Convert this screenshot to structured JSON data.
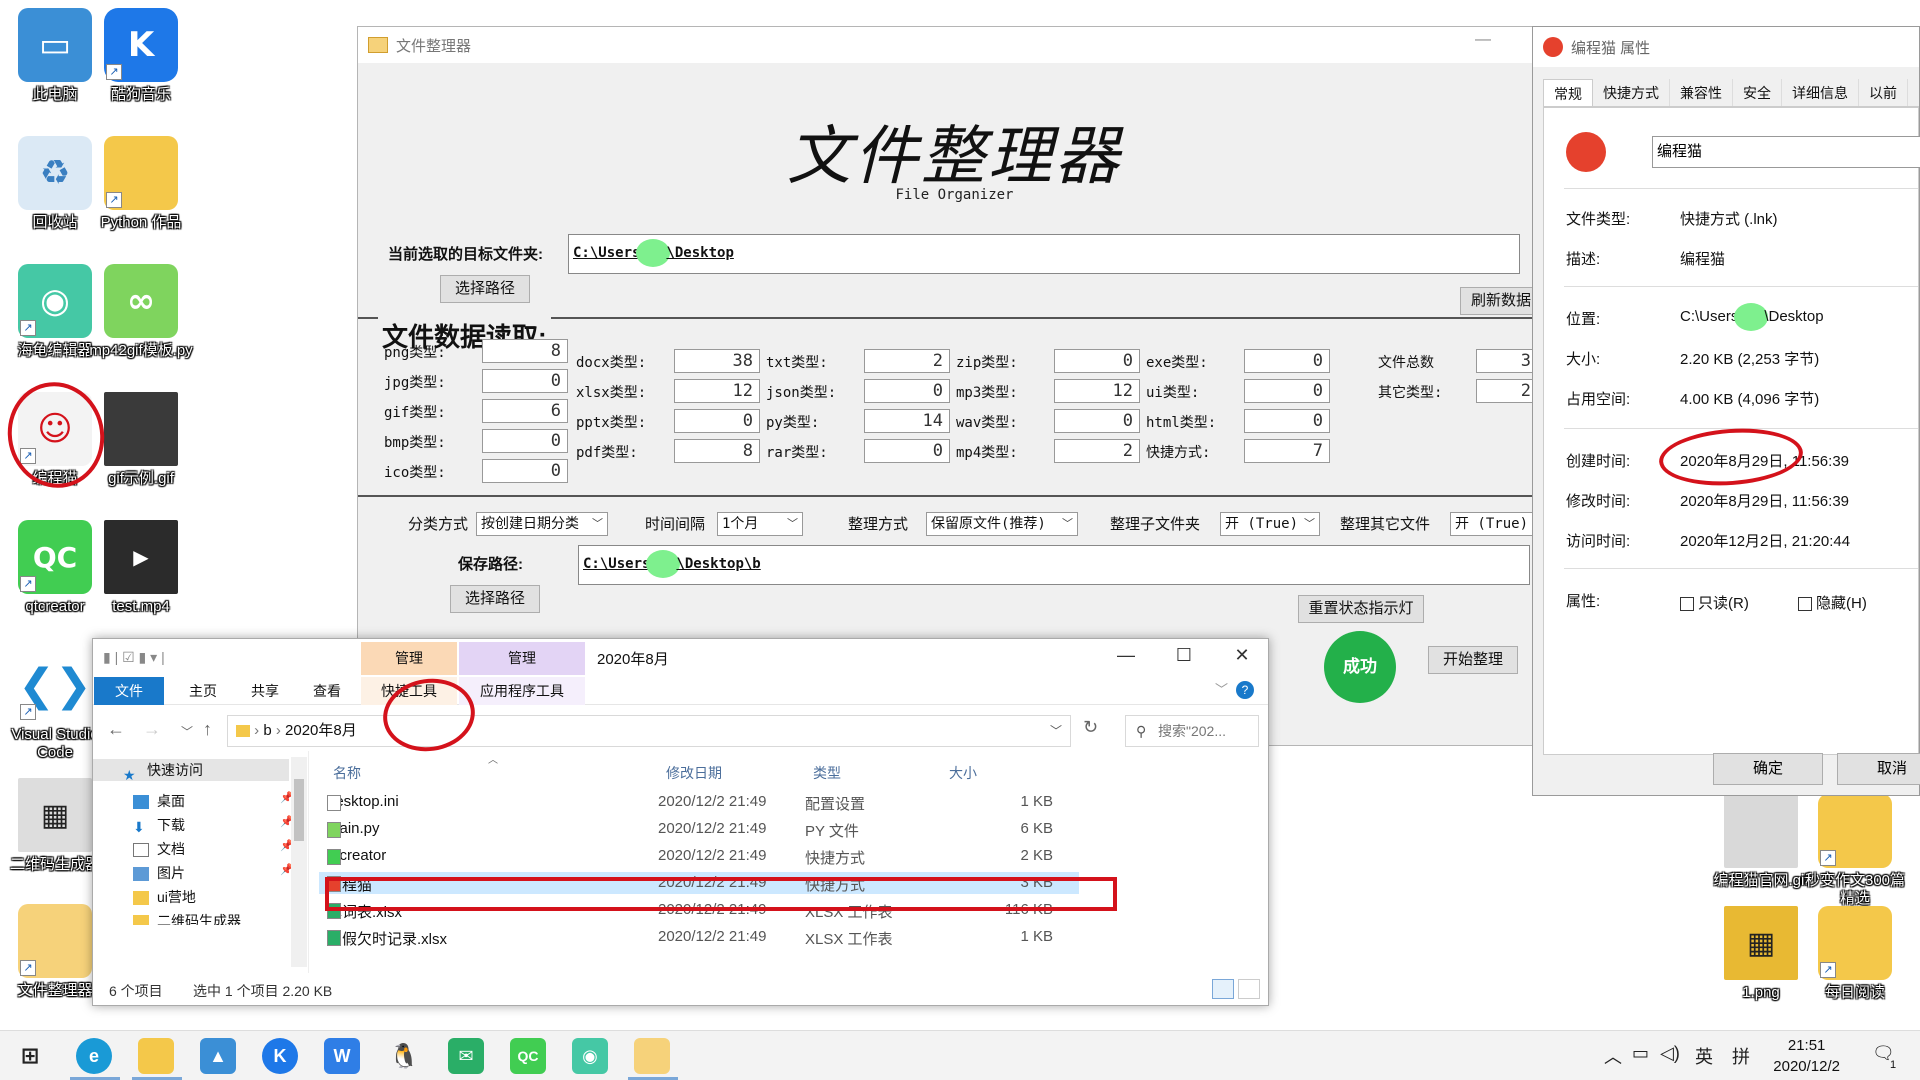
{
  "desktop": {
    "icons": [
      {
        "label": "此电脑"
      },
      {
        "label": "酷狗音乐"
      },
      {
        "label": "回收站"
      },
      {
        "label": "Python 作品"
      },
      {
        "label": "海龟编辑器"
      },
      {
        "label": "mp42gif模板.py"
      },
      {
        "label": "编程猫"
      },
      {
        "label": "gif示例.gif"
      },
      {
        "label": "qtcreator"
      },
      {
        "label": "test.mp4"
      },
      {
        "label": "Visual Studio Code"
      },
      {
        "label": "二维码生成器"
      },
      {
        "label": "文件整理器"
      },
      {
        "label": "编程猫官网.gif"
      },
      {
        "label": "秒变作文300篇精选"
      },
      {
        "label": "1.png"
      },
      {
        "label": "每日阅读"
      }
    ]
  },
  "app": {
    "window_title": "文件整理器",
    "title": "文件整理器",
    "subtitle": "File Organizer",
    "target_label": "当前选取的目标文件夹:",
    "target_path_a": "C:\\Users",
    "target_path_b": "\\Desktop",
    "choose_path_btn": "选择路径",
    "refresh_btn": "刷新数据",
    "section_title": "文件数据读取:",
    "stats": [
      {
        "label": "png类型:",
        "value": "8"
      },
      {
        "label": "jpg类型:",
        "value": "0"
      },
      {
        "label": "gif类型:",
        "value": "6"
      },
      {
        "label": "bmp类型:",
        "value": "0"
      },
      {
        "label": "ico类型:",
        "value": "0"
      },
      {
        "label": "docx类型:",
        "value": "38"
      },
      {
        "label": "xlsx类型:",
        "value": "12"
      },
      {
        "label": "pptx类型:",
        "value": "0"
      },
      {
        "label": "pdf类型:",
        "value": "8"
      },
      {
        "label": "txt类型:",
        "value": "2"
      },
      {
        "label": "json类型:",
        "value": "0"
      },
      {
        "label": "py类型:",
        "value": "14"
      },
      {
        "label": "rar类型:",
        "value": "0"
      },
      {
        "label": "zip类型:",
        "value": "0"
      },
      {
        "label": "mp3类型:",
        "value": "12"
      },
      {
        "label": "wav类型:",
        "value": "0"
      },
      {
        "label": "mp4类型:",
        "value": "2"
      },
      {
        "label": "exe类型:",
        "value": "0"
      },
      {
        "label": "ui类型:",
        "value": "0"
      },
      {
        "label": "html类型:",
        "value": "0"
      },
      {
        "label": "快捷方式:",
        "value": "7"
      },
      {
        "label": "文件总数",
        "value": "3"
      },
      {
        "label": "其它类型:",
        "value": "2"
      }
    ],
    "options": {
      "classify_label": "分类方式",
      "classify_value": "按创建日期分类",
      "interval_label": "时间间隔",
      "interval_value": "1个月",
      "organize_label": "整理方式",
      "organize_value": "保留原文件(推荐)",
      "subfolder_label": "整理子文件夹",
      "subfolder_value": "开 (True)",
      "other_label": "整理其它文件",
      "other_value": "开 (True)"
    },
    "save_label": "保存路径:",
    "save_path_a": "C:\\Users",
    "save_path_b": "\\Desktop\\b",
    "choose_path_btn2": "选择路径",
    "reset_btn": "重置状态指示灯",
    "success": "成功",
    "start_btn": "开始整理"
  },
  "props": {
    "title": "编程猫 属性",
    "tabs": [
      "常规",
      "快捷方式",
      "兼容性",
      "安全",
      "详细信息",
      "以前"
    ],
    "name": "编程猫",
    "rows": [
      {
        "k": "文件类型:",
        "v": "快捷方式 (.lnk)"
      },
      {
        "k": "描述:",
        "v": "编程猫"
      },
      {
        "k": "位置:",
        "v_a": "C:\\Users",
        "v_b": "\\Desktop"
      },
      {
        "k": "大小:",
        "v": "2.20 KB (2,253 字节)"
      },
      {
        "k": "占用空间:",
        "v": "4.00 KB (4,096 字节)"
      },
      {
        "k": "创建时间:",
        "v": "2020年8月29日, 11:56:39"
      },
      {
        "k": "修改时间:",
        "v": "2020年8月29日, 11:56:39"
      },
      {
        "k": "访问时间:",
        "v": "2020年12月2日, 21:20:44"
      },
      {
        "k": "属性:",
        "v": ""
      }
    ],
    "readonly": "只读(R)",
    "hidden": "隐藏(H)",
    "ok": "确定",
    "cancel": "取消"
  },
  "explorer": {
    "ctx1_header": "管理",
    "ctx1_tab": "快捷工具",
    "ctx2_header": "管理",
    "ctx2_tab": "应用程序工具",
    "title": "2020年8月",
    "ribbon": [
      "文件",
      "主页",
      "共享",
      "查看"
    ],
    "crumb_b": "b",
    "crumb_cur": "2020年8月",
    "search_placeholder": "搜索\"202...",
    "nav": [
      {
        "label": "快速访问"
      },
      {
        "label": "桌面"
      },
      {
        "label": "下载"
      },
      {
        "label": "文档"
      },
      {
        "label": "图片"
      },
      {
        "label": "ui营地"
      },
      {
        "label": "二维码生成器"
      }
    ],
    "cols": [
      "名称",
      "修改日期",
      "类型",
      "大小"
    ],
    "files": [
      {
        "name": "desktop.ini",
        "date": "2020/12/2 21:49",
        "type": "配置设置",
        "size": "1 KB"
      },
      {
        "name": "main.py",
        "date": "2020/12/2 21:49",
        "type": "PY 文件",
        "size": "6 KB"
      },
      {
        "name": "qtcreator",
        "date": "2020/12/2 21:49",
        "type": "快捷方式",
        "size": "2 KB"
      },
      {
        "name": "编程猫",
        "date": "2020/12/2 21:49",
        "type": "快捷方式",
        "size": "3 KB"
      },
      {
        "name": "单词表.xlsx",
        "date": "2020/12/2 21:49",
        "type": "XLSX 工作表",
        "size": "116 KB"
      },
      {
        "name": "暑假欠时记录.xlsx",
        "date": "2020/12/2 21:49",
        "type": "XLSX 工作表",
        "size": "1 KB"
      }
    ],
    "status_count": "6 个项目",
    "status_sel": "选中 1 个项目  2.20 KB"
  },
  "taskbar": {
    "ime": "英",
    "ime2": "拼",
    "time": "21:51",
    "date": "2020/12/2",
    "notify_count": "1"
  }
}
